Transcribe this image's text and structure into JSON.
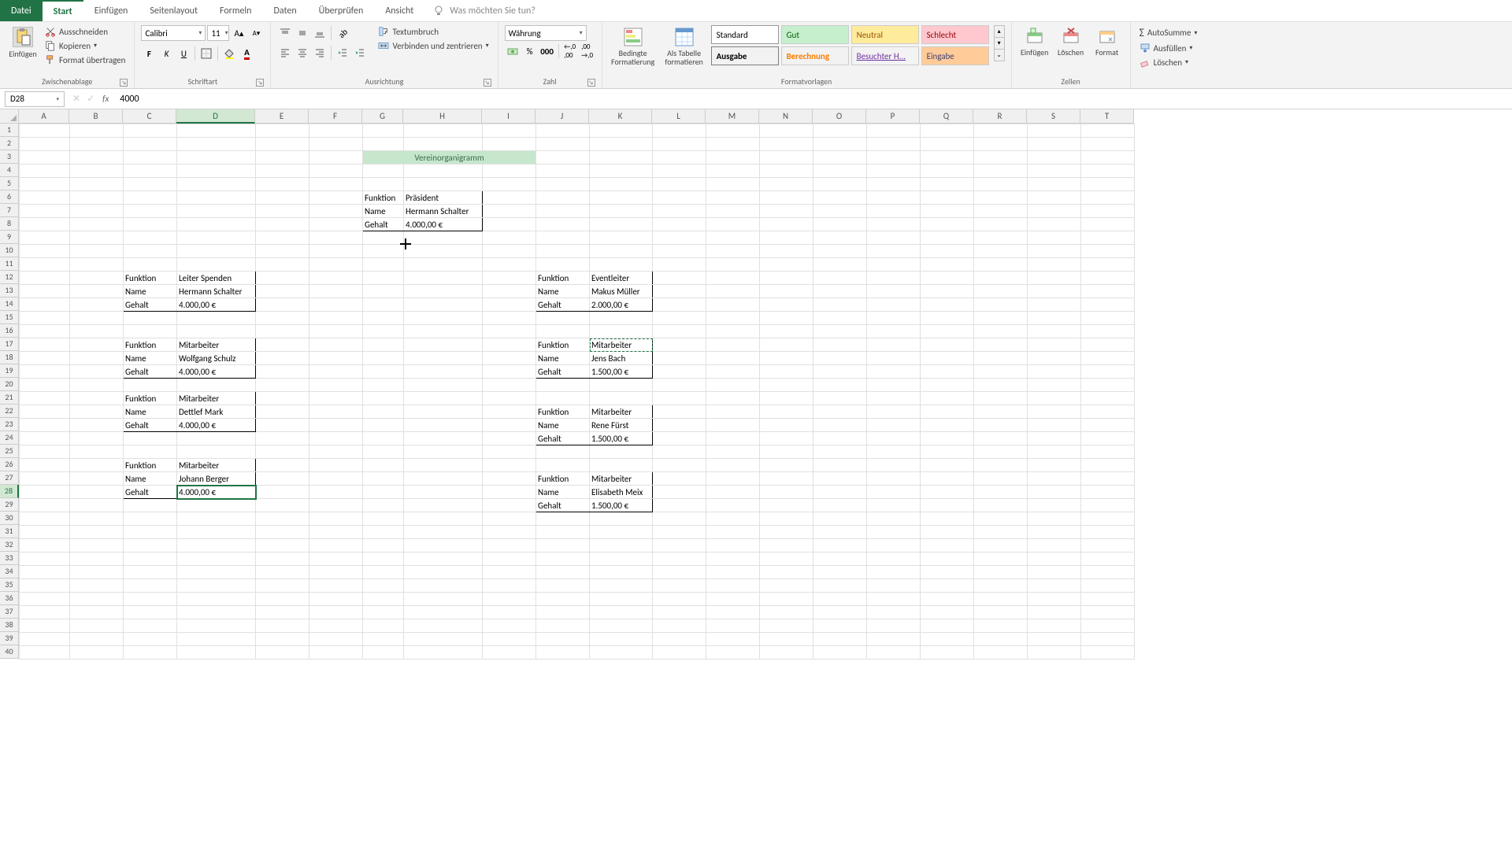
{
  "menu": {
    "file": "Datei",
    "tabs": [
      "Start",
      "Einfügen",
      "Seitenlayout",
      "Formeln",
      "Daten",
      "Überprüfen",
      "Ansicht"
    ],
    "active": "Start",
    "tellme": "Was möchten Sie tun?"
  },
  "ribbon": {
    "clipboard": {
      "paste": "Einfügen",
      "cut": "Ausschneiden",
      "copy": "Kopieren",
      "painter": "Format übertragen",
      "label": "Zwischenablage"
    },
    "font": {
      "name": "Calibri",
      "size": "11",
      "label": "Schriftart"
    },
    "alignment": {
      "wrap": "Textumbruch",
      "merge": "Verbinden und zentrieren",
      "label": "Ausrichtung"
    },
    "number": {
      "format": "Währung",
      "label": "Zahl"
    },
    "styles": {
      "cond": "Bedingte Formatierung",
      "table": "Als Tabelle formatieren",
      "items": {
        "standard": "Standard",
        "gut": "Gut",
        "neutral": "Neutral",
        "schlecht": "Schlecht",
        "ausgabe": "Ausgabe",
        "berechnung": "Berechnung",
        "besuchter": "Besuchter H...",
        "eingabe": "Eingabe"
      },
      "label": "Formatvorlagen"
    },
    "cells": {
      "insert": "Einfügen",
      "delete": "Löschen",
      "format": "Format",
      "label": "Zellen"
    },
    "editing": {
      "autosum": "AutoSumme",
      "fill": "Ausfüllen",
      "clear": "Löschen"
    }
  },
  "namebox": "D28",
  "formula": "4000",
  "columns": [
    "A",
    "B",
    "C",
    "D",
    "E",
    "F",
    "G",
    "H",
    "I",
    "J",
    "K",
    "L",
    "M",
    "N",
    "O",
    "P",
    "Q",
    "R",
    "S",
    "T"
  ],
  "colwidths": {
    "A": 64,
    "B": 68,
    "C": 68,
    "D": 100,
    "E": 68,
    "F": 68,
    "G": 52,
    "H": 100,
    "I": 68,
    "J": 68,
    "K": 80,
    "L": 68,
    "M": 68,
    "N": 68,
    "O": 68,
    "P": 68,
    "Q": 68,
    "R": 68,
    "S": 68,
    "T": 68
  },
  "selectedCol": "D",
  "selectedRow": 28,
  "sheet_title": "Vereinorganigramm",
  "labels": {
    "funktion": "Funktion",
    "name": "Name",
    "gehalt": "Gehalt"
  },
  "boxes": {
    "president": {
      "funktion": "Präsident",
      "name": "Hermann Schalter",
      "gehalt": "4.000,00 €"
    },
    "leftA": {
      "funktion": "Leiter Spenden",
      "name": "Hermann Schalter",
      "gehalt": "4.000,00 €"
    },
    "leftB": {
      "funktion": "Mitarbeiter",
      "name": "Wolfgang Schulz",
      "gehalt": "4.000,00 €"
    },
    "leftC": {
      "funktion": "Mitarbeiter",
      "name": "Dettlef Mark",
      "gehalt": "4.000,00 €"
    },
    "leftD": {
      "funktion": "Mitarbeiter",
      "name": "Johann Berger",
      "gehalt": "4.000,00 €"
    },
    "rightA": {
      "funktion": "Eventleiter",
      "name": "Makus Müller",
      "gehalt": "2.000,00 €"
    },
    "rightB": {
      "funktion": "Mitarbeiter",
      "name": "Jens Bach",
      "gehalt": "1.500,00 €"
    },
    "rightC": {
      "funktion": "Mitarbeiter",
      "name": "Rene Fürst",
      "gehalt": "1.500,00 €"
    },
    "rightD": {
      "funktion": "Mitarbeiter",
      "name": "Elisabeth Meix",
      "gehalt": "1.500,00 €"
    }
  }
}
